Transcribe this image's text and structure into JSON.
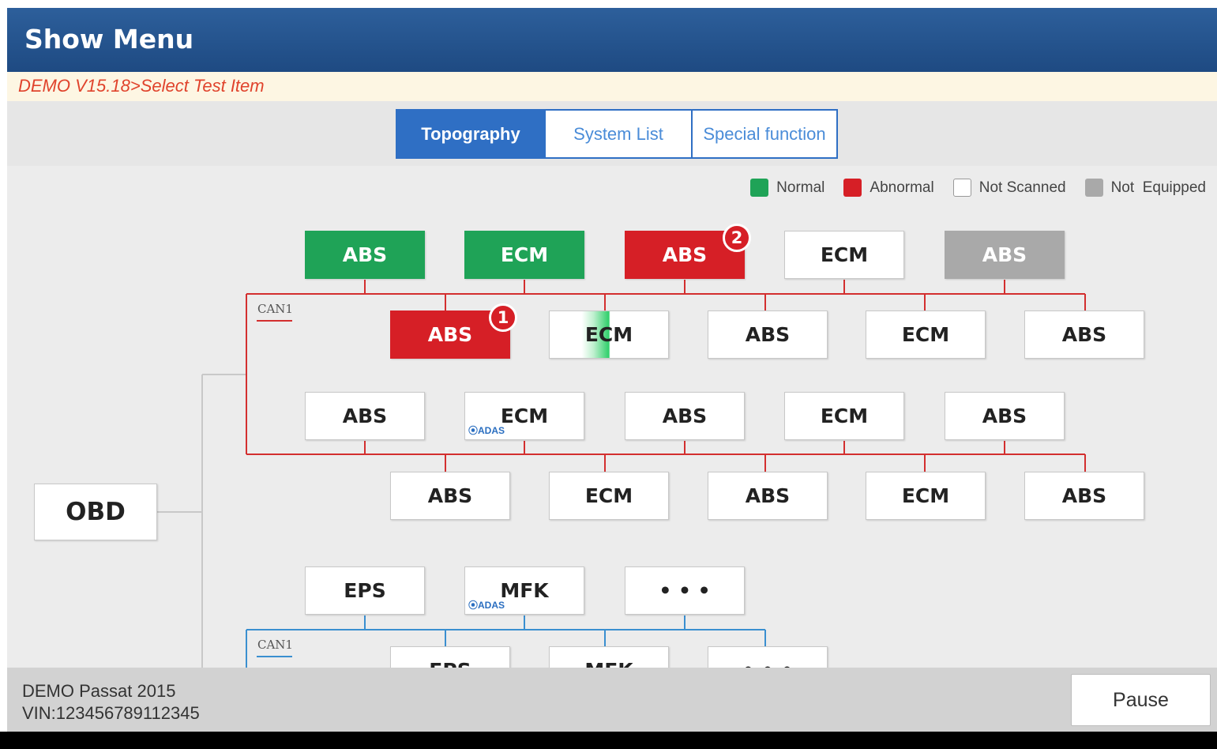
{
  "header": {
    "title": "Show Menu"
  },
  "breadcrumb": "DEMO V15.18>Select Test Item",
  "tabs": [
    "Topography",
    "System List",
    "Special function"
  ],
  "legend": [
    {
      "label": "Normal",
      "color": "#1fa357"
    },
    {
      "label": "Abnormal",
      "color": "#d61f26"
    },
    {
      "label": "Not Scanned",
      "color": "#ffffff"
    },
    {
      "label": "Not  Equipped",
      "color": "#a9a9a9"
    }
  ],
  "root_node": "OBD",
  "buses": [
    "CAN1",
    "CAN1"
  ],
  "bus_colors": {
    "red": "#d32f2f",
    "blue": "#3a8fd0"
  },
  "modules": {
    "row1": [
      "ABS",
      "ECM",
      "ABS",
      "ECM",
      "ABS"
    ],
    "row2": [
      "ABS",
      "ECM",
      "ABS",
      "ECM",
      "ABS"
    ],
    "row3": [
      "ABS",
      "ECM",
      "ABS",
      "ECM",
      "ABS"
    ],
    "row4": [
      "ABS",
      "ECM",
      "ABS",
      "ECM",
      "ABS"
    ],
    "row5": [
      "EPS",
      "MFK",
      "• • •"
    ],
    "row6": [
      "EPS",
      "MFK",
      "• • •"
    ]
  },
  "badges": [
    "1",
    "2"
  ],
  "adas_tag": "⦿ADAS",
  "footer": {
    "vehicle": "DEMO Passat 2015",
    "vin": "VIN:123456789112345"
  },
  "pause_label": "Pause"
}
